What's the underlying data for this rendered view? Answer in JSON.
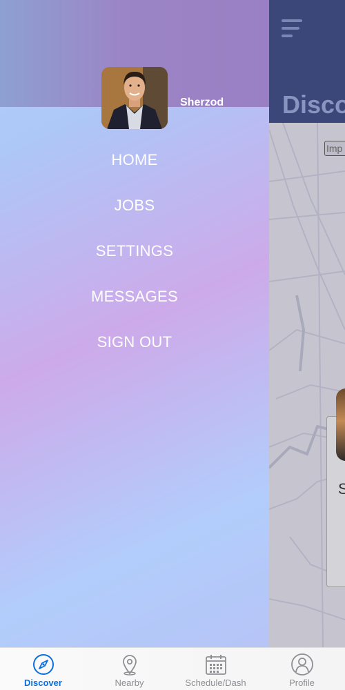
{
  "background_screen": {
    "title": "Disco",
    "map_label": "Imp",
    "card_letter": "S"
  },
  "drawer": {
    "user_name": "Sherzod",
    "menu": [
      {
        "label": "HOME"
      },
      {
        "label": "JOBS"
      },
      {
        "label": "SETTINGS"
      },
      {
        "label": "MESSAGES"
      },
      {
        "label": "SIGN OUT"
      }
    ]
  },
  "tabbar": {
    "tabs": [
      {
        "label": "Discover",
        "icon": "compass-icon",
        "active": true
      },
      {
        "label": "Nearby",
        "icon": "location-pin-icon",
        "active": false
      },
      {
        "label": "Schedule/Dash",
        "icon": "calendar-icon",
        "active": false
      },
      {
        "label": "Profile",
        "icon": "person-icon",
        "active": false
      }
    ]
  },
  "colors": {
    "active_tab": "#0a6fde",
    "inactive_tab": "#8e8e93",
    "header_bg": "#3c4779",
    "drawer_text": "#ffffff"
  }
}
